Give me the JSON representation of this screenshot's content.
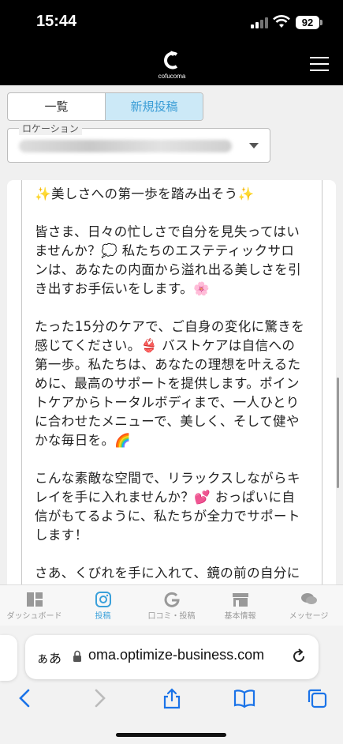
{
  "status_bar": {
    "time": "15:44",
    "battery": "92"
  },
  "header": {
    "logo_text": "cofucoma"
  },
  "tabs": [
    {
      "label": "一覧"
    },
    {
      "label": "新規投稿"
    }
  ],
  "location": {
    "label": "ロケーション"
  },
  "post": {
    "text": "✨美しさへの第一歩を踏み出そう✨\n\n皆さま、日々の忙しさで自分を見失ってはいませんか？💭 私たちのエステティックサロンは、あなたの内面から溢れ出る美しさを引き出すお手伝いをします。🌸\n\nたった15分のケアで、ご自身の変化に驚きを感じてください。👙 バストケアは自信への第一歩。私たちは、あなたの理想を叶えるために、最高のサポートを提供します。ポイントケアからトータルボディまで、一人ひとりに合わせたメニューで、美しく、そして健やかな毎日を。🌈\n\nこんな素敵な空間で、リラックスしながらキレイを手に入れませんか？💕 おっぱいに自信がもてるように、私たちが全力でサポートします！\n\nさあ、くびれを手に入れて、鏡の前の自分に恋をしましょう。💘\n\nお待ちしております！"
  },
  "bottom_nav": [
    {
      "label": "ダッシュボード",
      "icon": "dashboard-icon"
    },
    {
      "label": "投稿",
      "icon": "instagram-icon"
    },
    {
      "label": "口コミ・投稿",
      "icon": "google-icon"
    },
    {
      "label": "基本情報",
      "icon": "store-icon"
    },
    {
      "label": "メッセージ",
      "icon": "chat-icon"
    }
  ],
  "browser": {
    "aa_label": "ぁあ",
    "url": "oma.optimize-business.com"
  },
  "colors": {
    "accent": "#3aa0da",
    "tab_active_bg": "#cce9f7"
  }
}
